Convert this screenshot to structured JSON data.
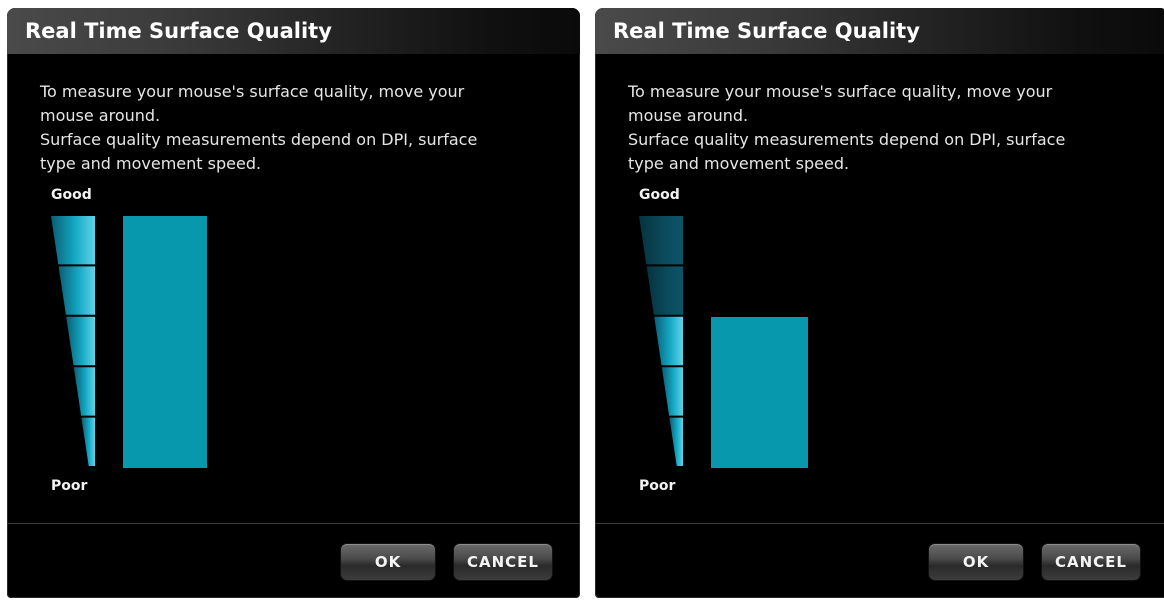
{
  "dialogs": [
    {
      "title": "Real Time Surface Quality",
      "description_lines": [
        "To measure your mouse's surface quality, move your",
        "mouse around.",
        "Surface quality measurements depend on DPI, surface",
        "type and movement speed."
      ],
      "scale_top_label": "Good",
      "scale_bottom_label": "Poor",
      "quality_level": 1.0,
      "lit_segments": 5,
      "ok_label": "OK",
      "cancel_label": "CANCEL"
    },
    {
      "title": "Real Time Surface Quality",
      "description_lines": [
        "To measure your mouse's surface quality, move your",
        "mouse around.",
        "Surface quality measurements depend on DPI, surface",
        "type and movement speed."
      ],
      "scale_top_label": "Good",
      "scale_bottom_label": "Poor",
      "quality_level": 0.6,
      "lit_segments": 3,
      "ok_label": "OK",
      "cancel_label": "CANCEL"
    }
  ],
  "colors": {
    "accent": "#0898ae",
    "segment_lit": "#14a9c4",
    "segment_dim": "#0b4a5c",
    "text": "#e6e6e6"
  }
}
